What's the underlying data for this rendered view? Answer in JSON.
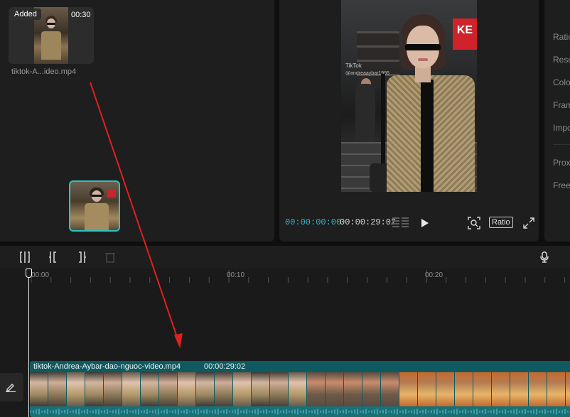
{
  "media": {
    "badge": "Added",
    "duration": "00:30",
    "filename": "tiktok-A...ideo.mp4"
  },
  "player": {
    "preview": {
      "watermark": "TikTok",
      "handle": "@andreaaybar1995",
      "sign_text": "KE"
    },
    "current_time": "00:00:00:00",
    "total_time": "00:00:29:02",
    "ratio_label": "Ratio"
  },
  "details": {
    "labels": [
      "Ratio",
      "Resolution",
      "Color",
      "Frame rate",
      "Import",
      "Proxy",
      "Free layer"
    ]
  },
  "toolbar": {
    "icons": [
      "split-icon",
      "split-left-icon",
      "split-right-icon",
      "delete-icon",
      "microphone-icon"
    ]
  },
  "ruler": {
    "labels": [
      "00:00",
      "00:10",
      "00:20"
    ]
  },
  "clip": {
    "title": "tiktok-Andrea-Aybar-dao-nguoc-video.mp4",
    "duration": "00:00:29:02"
  },
  "colors": {
    "accent": "#35b6c4",
    "clip_bg": "#0f5a61",
    "drag_border": "#2ac4c4",
    "arrow": "#e02020"
  }
}
